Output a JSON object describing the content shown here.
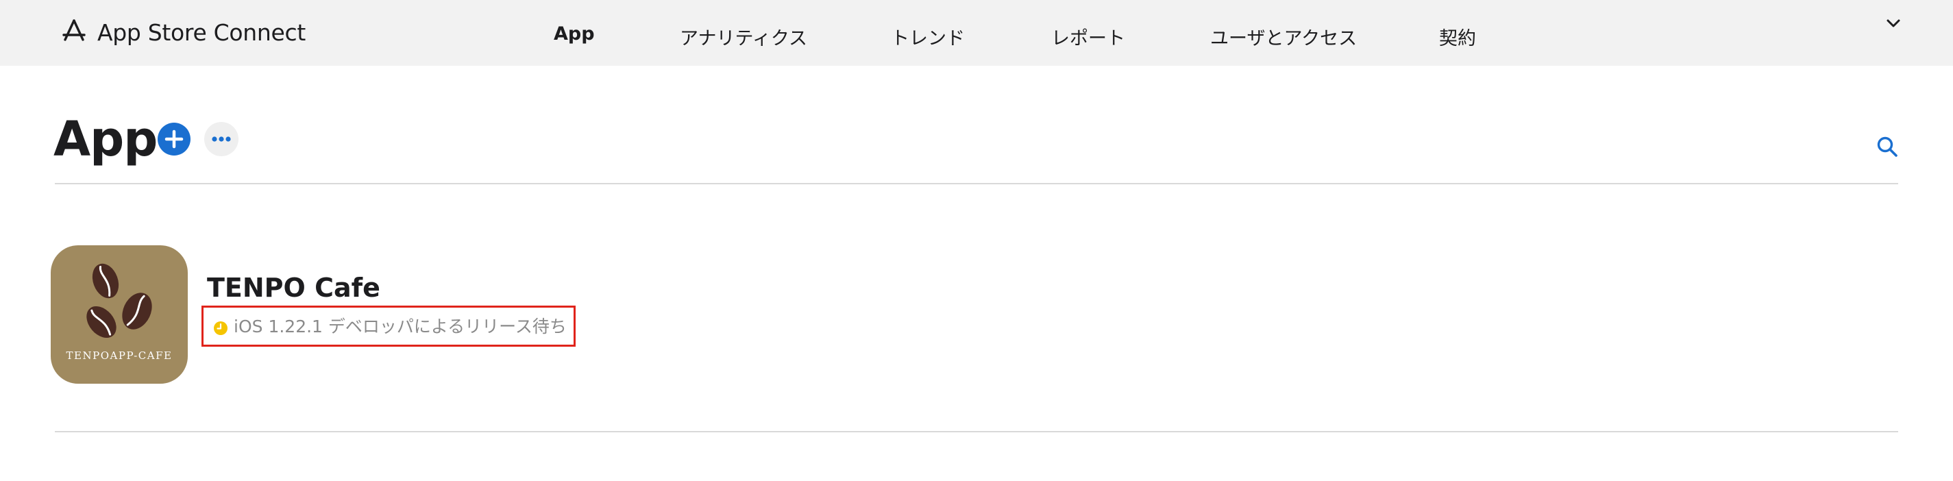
{
  "header": {
    "brand_label": "App Store Connect",
    "brand_icon": "app-store-icon",
    "nav": [
      {
        "label": "App",
        "active": true
      },
      {
        "label": "アナリティクス",
        "active": false
      },
      {
        "label": "トレンド",
        "active": false
      },
      {
        "label": "レポート",
        "active": false
      },
      {
        "label": "ユーザとアクセス",
        "active": false
      },
      {
        "label": "契約",
        "active": false
      }
    ],
    "account_menu_icon": "chevron-down-icon"
  },
  "page": {
    "title": "App",
    "add_icon": "plus-icon",
    "more_icon": "ellipsis-icon",
    "search_icon": "search-icon"
  },
  "apps": [
    {
      "name": "TENPO Cafe",
      "icon_caption": "TENPOAPP-CAFE",
      "status_text": "iOS 1.22.1 デベロッパによるリリース待ち",
      "status_icon": "clock-icon",
      "status_color": "#f5c400",
      "highlight_color": "#e0241b"
    }
  ],
  "colors": {
    "accent": "#1a6fd0",
    "topbar_bg": "#f2f2f2",
    "icon_bg": "#a08a5f",
    "bean": "#4a2a22"
  }
}
